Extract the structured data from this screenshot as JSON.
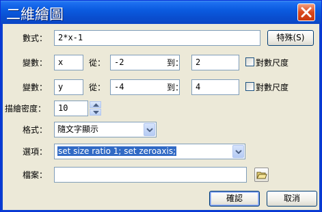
{
  "window": {
    "title": "二維繪圖"
  },
  "expression": {
    "label": "數式：",
    "value": "2*x-1",
    "special_button": "特殊(S)"
  },
  "var1": {
    "label": "變數：",
    "name": "x",
    "from_label": "從：",
    "from": "-2",
    "to_label": "到：",
    "to": "2",
    "log_label": "對數尺度"
  },
  "var2": {
    "label": "變數：",
    "name": "y",
    "from_label": "從：",
    "from": "-4",
    "to_label": "到：",
    "to": "4",
    "log_label": "對數尺度"
  },
  "density": {
    "label": "描繪密度：",
    "value": "10"
  },
  "format": {
    "label": "格式：",
    "selected": "隨文字顯示"
  },
  "options": {
    "label": "選項：",
    "selected": "set size ratio 1; set zeroaxis;"
  },
  "file": {
    "label": "檔案：",
    "value": ""
  },
  "buttons": {
    "ok": "確認",
    "cancel": "取消"
  },
  "colors": {
    "titlebar": "#0a4fd0",
    "client": "#ece9d8",
    "selection": "#316ac5",
    "field_border": "#7f9db9"
  },
  "icons": [
    "close-icon",
    "chevron-down-icon",
    "spin-up-icon",
    "spin-down-icon",
    "folder-open-icon"
  ]
}
